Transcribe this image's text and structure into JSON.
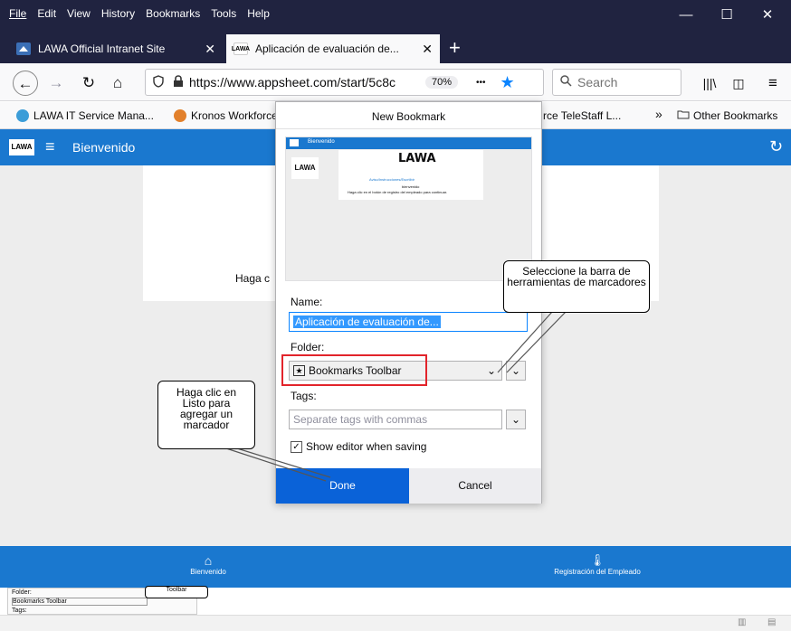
{
  "menu": [
    "File",
    "Edit",
    "View",
    "History",
    "Bookmarks",
    "Tools",
    "Help"
  ],
  "window_controls": {
    "minimize": "—",
    "maximize": "☐",
    "close": "✕"
  },
  "tabs": [
    {
      "title": "LAWA Official Intranet Site",
      "active": false,
      "close": "✕"
    },
    {
      "title": "Aplicación de evaluación de...",
      "active": true,
      "close": "✕"
    }
  ],
  "new_tab": "+",
  "nav": {
    "url": "https://www.appsheet.com/start/5c8c",
    "zoom": "70%",
    "more": "•••",
    "search_placeholder": "Search"
  },
  "bookmarks_toolbar": {
    "items": [
      "LAWA IT Service Mana...",
      "Kronos Workforce",
      "rce TeleStaff L..."
    ],
    "overflow": "»",
    "other": "Other Bookmarks"
  },
  "app": {
    "title": "Bienvenido",
    "logo": "LAWA",
    "body_text": "Haga c",
    "footer": [
      {
        "icon": "home-icon",
        "label": "Bienvenido"
      },
      {
        "icon": "thermometer-icon",
        "label": "Registración del Empleado"
      }
    ]
  },
  "popup": {
    "title": "New Bookmark",
    "preview": {
      "header": "Bienvenido",
      "logo": "LAWA",
      "logo_small": "LAWA",
      "line1": "Aviso/Instrucciones/Escrtibir",
      "line2": "bienvenido",
      "line3": "Haga clic en el botón de registro del empleado para continuar."
    },
    "name_label": "Name:",
    "name_value": "Aplicación de evaluación de...",
    "folder_label": "Folder:",
    "folder_value": "Bookmarks Toolbar",
    "tags_label": "Tags:",
    "tags_placeholder": "Separate tags with commas",
    "show_editor": "Show editor when saving",
    "done": "Done",
    "cancel": "Cancel"
  },
  "callouts": {
    "folder_hint": "Seleccione la barra de herramientas de marcadores",
    "done_hint": "Haga clic en Listo para agregar un marcador"
  },
  "bottom_leftover": {
    "folder_label": "Folder:",
    "folder_value": "Bookmarks Toolbar",
    "tags_label": "Tags:",
    "toolbar_frag": "Toolbar"
  },
  "colors": {
    "accent": "#1a78cf",
    "done": "#0a62d8",
    "highlight": "#e2242b",
    "titlebar": "#202340"
  }
}
